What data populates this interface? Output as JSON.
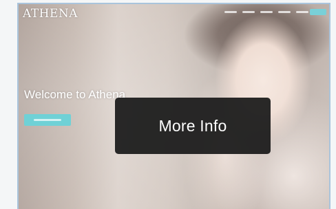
{
  "header": {
    "brand": "ATHENA"
  },
  "hero": {
    "title": "Welcome to Athena"
  },
  "overlay": {
    "label": "More Info"
  },
  "colors": {
    "accent": "#6fd1d6",
    "overlay_bg": "#1c1c1c",
    "frame_border": "#a9c4dc"
  }
}
